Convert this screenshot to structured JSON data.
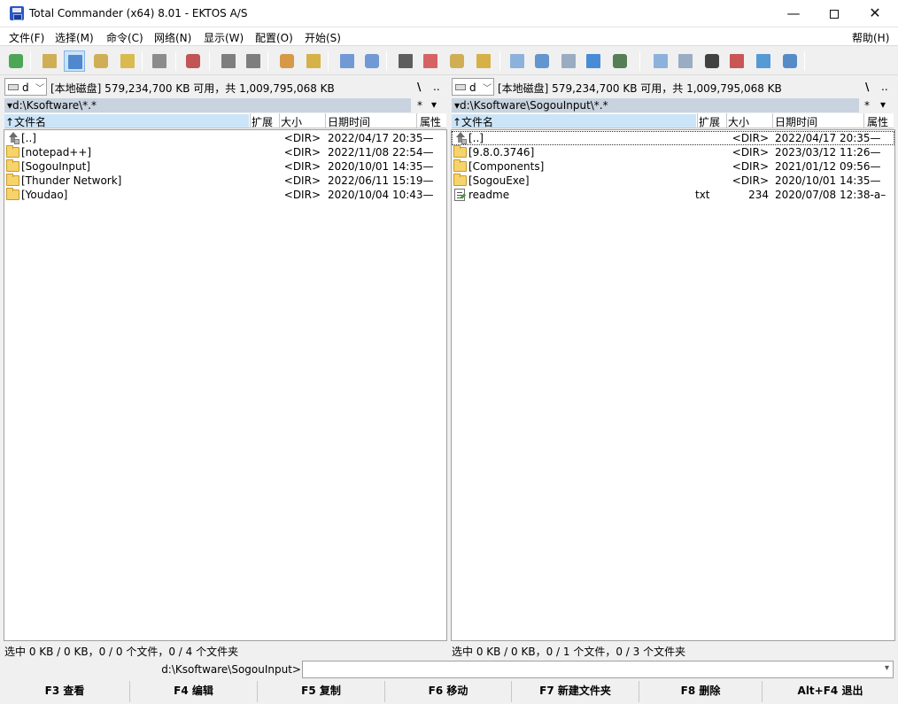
{
  "window": {
    "title": "Total Commander (x64) 8.01 - EKTOS A/S",
    "min_glyph": "—",
    "close_glyph": "✕"
  },
  "menu": {
    "items": [
      "文件(F)",
      "选择(M)",
      "命令(C)",
      "网络(N)",
      "显示(W)",
      "配置(O)",
      "开始(S)"
    ],
    "help": "帮助(H)"
  },
  "toolbar": {
    "icons": [
      "refresh-icon",
      "brief-view-icon",
      "detailed-view-icon",
      "thumbnails-icon",
      "tree-view-icon",
      "compare-dirs-icon",
      "invert-selection-icon",
      "back-icon",
      "forward-icon",
      "pack-icon",
      "unpack-icon",
      "ftp-connect-icon",
      "ftp-url-icon",
      "find-files-icon",
      "multi-rename-icon",
      "sync-dirs-icon",
      "copy-names-icon",
      "notepad-icon",
      "control-panel-icon",
      "calculator-icon",
      "internet-explorer-icon",
      "remote-desktop-icon",
      "wordpad-icon",
      "calc-icon",
      "cmd-prompt-icon",
      "phone-icon",
      "network-icon",
      "display-icon"
    ]
  },
  "left": {
    "drive_letter": "d",
    "drive_info": "[本地磁盘]  579,234,700 KB 可用，共 1,009,795,068 KB",
    "root": "\\",
    "up": "..",
    "path": "▾d:\\Ksoftware\\*.*",
    "filter": "*",
    "filter_chev": "▾",
    "columns": {
      "name": "↑文件名",
      "ext": "扩展",
      "size": "大小",
      "date": "日期时间",
      "attr": "属性"
    },
    "rows": [
      {
        "type": "up",
        "name": "[..]",
        "ext": "",
        "size": "<DIR>",
        "date": "2022/04/17 20:35—",
        "focus": false
      },
      {
        "type": "folder",
        "name": "[notepad++]",
        "ext": "",
        "size": "<DIR>",
        "date": "2022/11/08 22:54—",
        "focus": false
      },
      {
        "type": "folder",
        "name": "[SogouInput]",
        "ext": "",
        "size": "<DIR>",
        "date": "2020/10/01 14:35—",
        "focus": false
      },
      {
        "type": "folder",
        "name": "[Thunder Network]",
        "ext": "",
        "size": "<DIR>",
        "date": "2022/06/11 15:19—",
        "focus": false
      },
      {
        "type": "folder",
        "name": "[Youdao]",
        "ext": "",
        "size": "<DIR>",
        "date": "2020/10/04 10:43—",
        "focus": false
      }
    ],
    "status": "选中 0 KB / 0 KB，0 / 0 个文件，0 / 4 个文件夹"
  },
  "right": {
    "drive_letter": "d",
    "drive_info": "[本地磁盘]  579,234,700 KB 可用，共 1,009,795,068 KB",
    "root": "\\",
    "up": "..",
    "path": "▾d:\\Ksoftware\\SogouInput\\*.*",
    "filter": "*",
    "filter_chev": "▾",
    "columns": {
      "name": "↑文件名",
      "ext": "扩展",
      "size": "大小",
      "date": "日期时间",
      "attr": "属性"
    },
    "rows": [
      {
        "type": "up",
        "name": "[..]",
        "ext": "",
        "size": "<DIR>",
        "date": "2022/04/17 20:35—",
        "focus": true
      },
      {
        "type": "folder",
        "name": "[9.8.0.3746]",
        "ext": "",
        "size": "<DIR>",
        "date": "2023/03/12 11:26—",
        "focus": false
      },
      {
        "type": "folder",
        "name": "[Components]",
        "ext": "",
        "size": "<DIR>",
        "date": "2021/01/12 09:56—",
        "focus": false
      },
      {
        "type": "folder",
        "name": "[SogouExe]",
        "ext": "",
        "size": "<DIR>",
        "date": "2020/10/01 14:35—",
        "focus": false
      },
      {
        "type": "file",
        "name": "readme",
        "ext": "txt",
        "size": "234",
        "date": "2020/07/08 12:38-a–",
        "focus": false
      }
    ],
    "status": "选中 0 KB / 0 KB，0 / 1 个文件，0 / 3 个文件夹"
  },
  "cmdline": {
    "label": "d:\\Ksoftware\\SogouInput>",
    "value": "",
    "chev": "▾"
  },
  "fkeys": [
    "F3 查看",
    "F4 编辑",
    "F5 复制",
    "F6 移动",
    "F7 新建文件夹",
    "F8 删除",
    "Alt+F4 退出"
  ],
  "colors": {
    "path_bg": "#c9d3df",
    "name_header_bg": "#cce4f7",
    "folder": "#f6d36b"
  }
}
